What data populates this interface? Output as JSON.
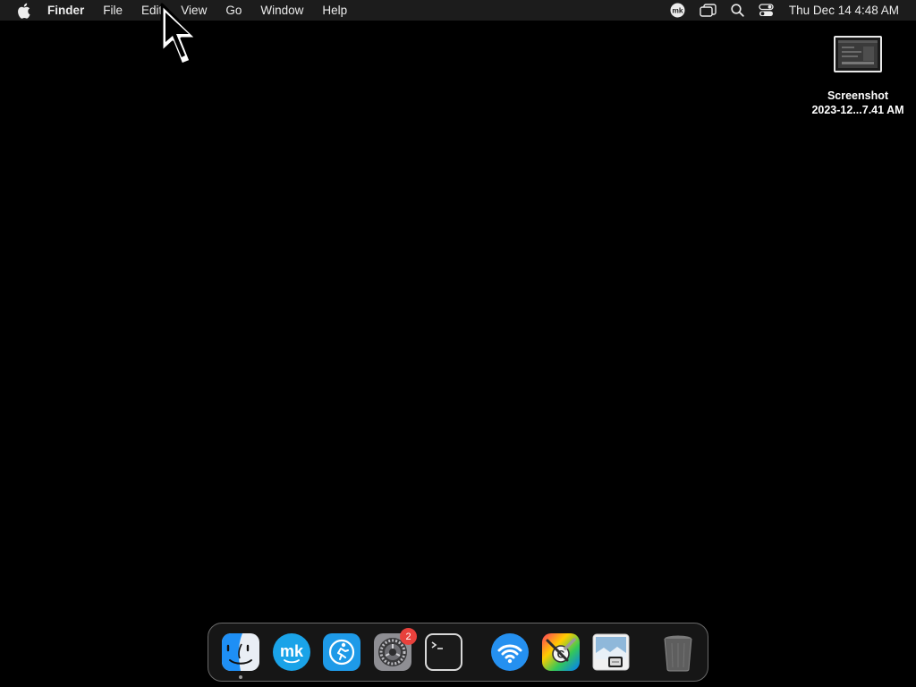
{
  "menubar": {
    "apple_icon": "apple-logo",
    "app_name": "Finder",
    "items": [
      "File",
      "Edit",
      "View",
      "Go",
      "Window",
      "Help"
    ],
    "status_icons": [
      "mk-icon",
      "screen-mirroring-icon",
      "spotlight-search-icon",
      "control-center-icon"
    ],
    "clock": "Thu Dec 14  4:48 AM"
  },
  "desktop": {
    "file": {
      "line1": "Screenshot",
      "line2": "2023-12...7.41 AM"
    }
  },
  "dock": {
    "apps": [
      {
        "icon": "finder-icon",
        "running": true
      },
      {
        "icon": "mk-app-icon",
        "running": false
      },
      {
        "icon": "run-app-icon",
        "running": false
      },
      {
        "icon": "system-settings-icon",
        "running": false,
        "badge": "2"
      },
      {
        "icon": "terminal-icon",
        "running": false
      }
    ],
    "others": [
      {
        "icon": "wireless-diagnostics-icon"
      },
      {
        "icon": "colorsync-utility-icon"
      },
      {
        "icon": "preview-icon"
      }
    ],
    "trash": {
      "icon": "trash-icon"
    }
  },
  "colors": {
    "desktop_background": "#000000",
    "menubar_background": "#1c1c1c",
    "badge": "#e8413c",
    "accent_blue": "#1e8ff5"
  }
}
